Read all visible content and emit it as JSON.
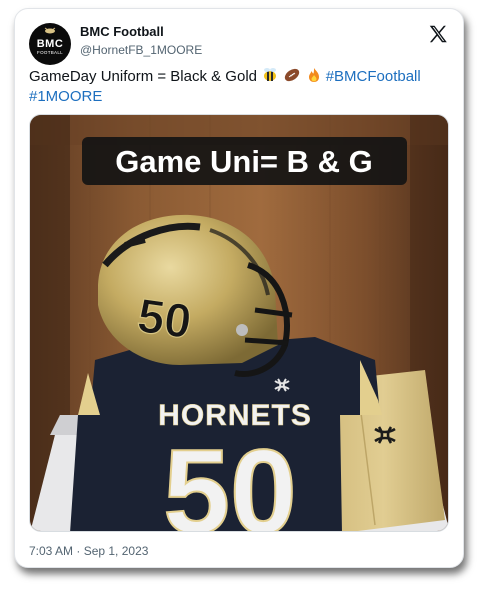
{
  "account": {
    "name": "BMC Football",
    "handle": "@HornetFB_1MOORE",
    "avatar_text": "BMC",
    "avatar_subtext": "FOOTBALL"
  },
  "tweet": {
    "text": "GameDay Uniform = Black & Gold",
    "emojis": [
      "bee-icon",
      "football-icon",
      "fire-icon"
    ],
    "hashtag1": "#BMCFootball",
    "hashtag2": "#1MOORE"
  },
  "media": {
    "overlay_caption": "Game Uni= B & G",
    "helmet_number": "50",
    "jersey_text": "HORNETS",
    "jersey_number": "50"
  },
  "timestamp": "7:03 AM · Sep 1, 2023",
  "colors": {
    "link": "#1d6fbf",
    "navy": "#1b2233",
    "gold": "#d8c285",
    "wood": "#8a5a33"
  }
}
